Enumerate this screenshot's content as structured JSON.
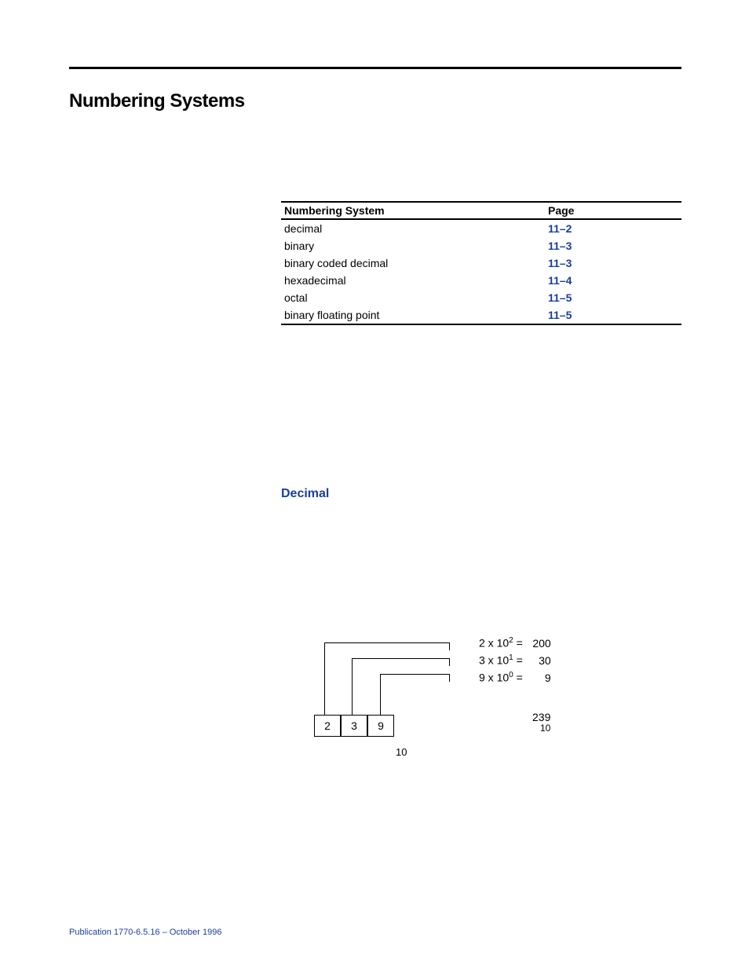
{
  "title": "Numbering Systems",
  "table": {
    "headers": {
      "system": "Numbering System",
      "page": "Page"
    },
    "rows": [
      {
        "system": "decimal",
        "page": "11–2"
      },
      {
        "system": "binary",
        "page": "11–3"
      },
      {
        "system": "binary coded decimal",
        "page": "11–3"
      },
      {
        "system": "hexadecimal",
        "page": "11–4"
      },
      {
        "system": "octal",
        "page": "11–5"
      },
      {
        "system": "binary floating point",
        "page": "11–5"
      }
    ]
  },
  "subhead": "Decimal",
  "diagram": {
    "digits": [
      "2",
      "3",
      "9"
    ],
    "base_label": "10",
    "lines": [
      {
        "coef": "2",
        "base": "10",
        "exp": "2",
        "val": "200"
      },
      {
        "coef": "3",
        "base": "10",
        "exp": "1",
        "val": "30"
      },
      {
        "coef": "9",
        "base": "10",
        "exp": "0",
        "val": "9"
      }
    ],
    "sum": "239",
    "sum_sub": "10"
  },
  "publication": "Publication 1770-6.5.16 – October 1996"
}
